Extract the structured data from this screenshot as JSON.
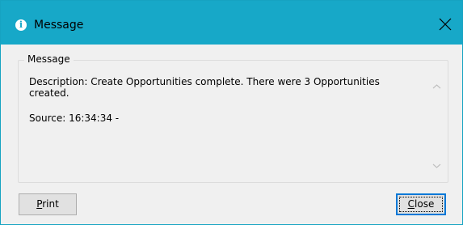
{
  "window": {
    "title": "Message",
    "title_icon": "info-icon",
    "accent_color": "#17a8c8"
  },
  "group": {
    "label": "Message"
  },
  "message": {
    "description": "Description: Create Opportunities complete. There were 3 Opportunities\ncreated.",
    "source": "Source:  16:34:34 -"
  },
  "buttons": {
    "print_label_mnemonic": "P",
    "print_label_rest": "rint",
    "close_label_mnemonic": "C",
    "close_label_rest": "lose"
  }
}
